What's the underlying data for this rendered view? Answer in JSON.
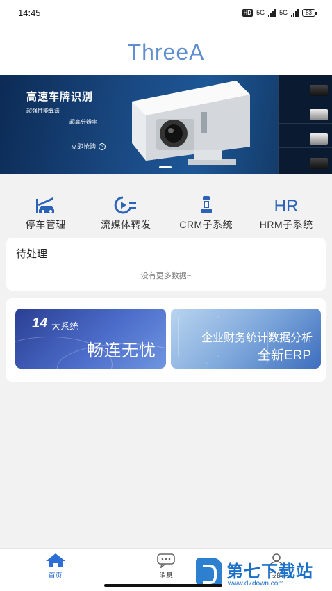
{
  "status": {
    "time": "14:45",
    "hd": "HD",
    "net1": "5G",
    "net2": "5G",
    "battery": "83"
  },
  "app": {
    "title": "ThreeA"
  },
  "banner": {
    "title": "高速车牌识别",
    "subtitle1": "超强性能算法",
    "subtitle2": "超高分辨率",
    "cta": "立即抢购"
  },
  "menu": [
    {
      "label": "停车管理",
      "icon": "parking-icon"
    },
    {
      "label": "流媒体转发",
      "icon": "stream-icon"
    },
    {
      "label": "CRM子系统",
      "icon": "crm-icon"
    },
    {
      "label": "HRM子系统",
      "icon": "hrm-icon",
      "icon_text": "HR"
    }
  ],
  "pending": {
    "title": "待处理",
    "empty_text": "没有更多数据~"
  },
  "promos": {
    "left": {
      "number": "14",
      "small": "大系统",
      "big": "畅连无忧"
    },
    "right": {
      "line1": "企业财务统计数据分析",
      "line2": "全新ERP"
    }
  },
  "tabs": [
    {
      "label": "首页",
      "icon": "home-icon",
      "active": true
    },
    {
      "label": "消息",
      "icon": "message-icon",
      "active": false
    },
    {
      "label": "我的",
      "icon": "profile-icon",
      "active": false
    }
  ],
  "colors": {
    "accent": "#2d6fd6",
    "title": "#5f8fd0",
    "icon": "#2a63b8"
  }
}
